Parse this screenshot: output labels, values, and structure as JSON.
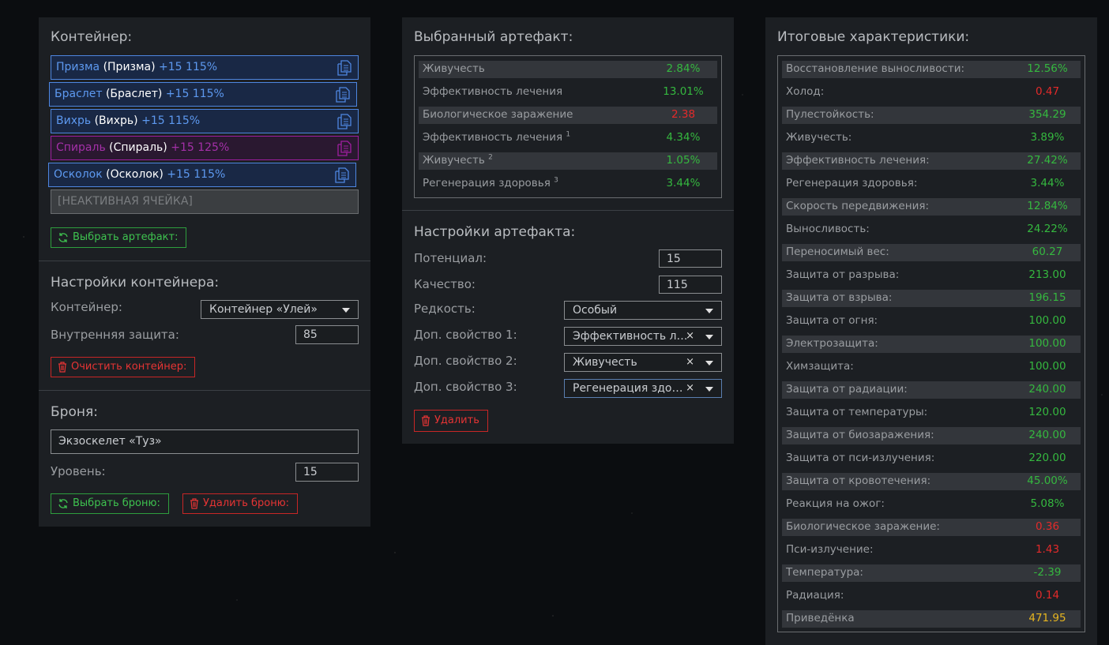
{
  "container_panel": {
    "title": "Контейнер:",
    "slots": [
      {
        "name": "Призма",
        "name2": "(Призма)",
        "level": "+15 115%",
        "color": "blue"
      },
      {
        "name": "Браслет",
        "name2": "(Браслет)",
        "level": "+15 115%",
        "color": "blue"
      },
      {
        "name": "Вихрь",
        "name2": "(Вихрь)",
        "level": "+15 115%",
        "color": "blue"
      },
      {
        "name": "Спираль",
        "name2": "(Спираль)",
        "level": "+15 125%",
        "color": "purple"
      },
      {
        "name": "Осколок",
        "name2": "(Осколок)",
        "level": "+15 115%",
        "color": "blue"
      }
    ],
    "inactive_slot": "[НЕАКТИВНАЯ ЯЧЕЙКА]",
    "select_artefact_btn": "Выбрать артефакт:",
    "settings_title": "Настройки контейнера:",
    "container_label": "Контейнер:",
    "container_value": "Контейнер «Улей»",
    "inner_protection_label": "Внутренняя защита:",
    "inner_protection_value": "85",
    "clear_btn": "Очистить контейнер:",
    "armor_title": "Броня:",
    "armor_value": "Экзоскелет «Туз»",
    "level_label": "Уровень:",
    "level_value": "15",
    "select_armor_btn": "Выбрать броню:",
    "delete_armor_btn": "Удалить броню:"
  },
  "artefact_panel": {
    "title": "Выбранный артефакт:",
    "stats": [
      {
        "name": "Живучесть",
        "sup": "",
        "value": "2.84%",
        "tone": "g"
      },
      {
        "name": "Эффективность лечения",
        "sup": "",
        "value": "13.01%",
        "tone": "g"
      },
      {
        "name": "Биологическое заражение",
        "sup": "",
        "value": "2.38",
        "tone": "r"
      },
      {
        "name": "Эффективность лечения",
        "sup": "1",
        "value": "4.34%",
        "tone": "g"
      },
      {
        "name": "Живучесть",
        "sup": "2",
        "value": "1.05%",
        "tone": "g"
      },
      {
        "name": "Регенерация здоровья",
        "sup": "3",
        "value": "3.44%",
        "tone": "g"
      }
    ],
    "settings_title": "Настройки артефакта:",
    "potential_label": "Потенциал:",
    "potential_value": "15",
    "quality_label": "Качество:",
    "quality_value": "115",
    "rarity_label": "Редкость:",
    "rarity_value": "Особый",
    "extra1_label": "Доп. свойство 1:",
    "extra1_value": "Эффективность лечения",
    "extra2_label": "Доп. свойство 2:",
    "extra2_value": "Живучесть",
    "extra3_label": "Доп. свойство 3:",
    "extra3_value": "Регенерация здоровья",
    "clear_symbol": "×",
    "delete_btn": "Удалить"
  },
  "totals_panel": {
    "title": "Итоговые характеристики:",
    "stats": [
      {
        "name": "Восстановление выносливости:",
        "value": "12.56%",
        "tone": "g"
      },
      {
        "name": "Холод:",
        "value": "0.47",
        "tone": "r"
      },
      {
        "name": "Пулестойкость:",
        "value": "354.29",
        "tone": "g"
      },
      {
        "name": "Живучесть:",
        "value": "3.89%",
        "tone": "g"
      },
      {
        "name": "Эффективность лечения:",
        "value": "27.42%",
        "tone": "g"
      },
      {
        "name": "Регенерация здоровья:",
        "value": "3.44%",
        "tone": "g"
      },
      {
        "name": "Скорость передвижения:",
        "value": "12.84%",
        "tone": "g"
      },
      {
        "name": "Выносливость:",
        "value": "24.22%",
        "tone": "g"
      },
      {
        "name": "Переносимый вес:",
        "value": "60.27",
        "tone": "g"
      },
      {
        "name": "Защита от разрыва:",
        "value": "213.00",
        "tone": "g"
      },
      {
        "name": "Защита от взрыва:",
        "value": "196.15",
        "tone": "g"
      },
      {
        "name": "Защита от огня:",
        "value": "100.00",
        "tone": "g"
      },
      {
        "name": "Электрозащита:",
        "value": "100.00",
        "tone": "g"
      },
      {
        "name": "Химзащита:",
        "value": "100.00",
        "tone": "g"
      },
      {
        "name": "Защита от радиации:",
        "value": "240.00",
        "tone": "g"
      },
      {
        "name": "Защита от температуры:",
        "value": "120.00",
        "tone": "g"
      },
      {
        "name": "Защита от биозаражения:",
        "value": "240.00",
        "tone": "g"
      },
      {
        "name": "Защита от пси-излучения:",
        "value": "220.00",
        "tone": "g"
      },
      {
        "name": "Защита от кровотечения:",
        "value": "45.00%",
        "tone": "g"
      },
      {
        "name": "Реакция на ожог:",
        "value": "5.08%",
        "tone": "g"
      },
      {
        "name": "Биологическое заражение:",
        "value": "0.36",
        "tone": "r"
      },
      {
        "name": "Пси-излучение:",
        "value": "1.43",
        "tone": "r"
      },
      {
        "name": "Температура:",
        "value": "-2.39",
        "tone": "g"
      },
      {
        "name": "Радиация:",
        "value": "0.14",
        "tone": "r"
      },
      {
        "name": "Приведёнка",
        "value": "471.95",
        "tone": "y"
      }
    ]
  },
  "colors": {
    "positive": "#35b83f",
    "negative": "#e32a2a",
    "highlight": "#e6b520",
    "slot_blue": "#4e86e0",
    "slot_purple": "#a01ea0"
  }
}
